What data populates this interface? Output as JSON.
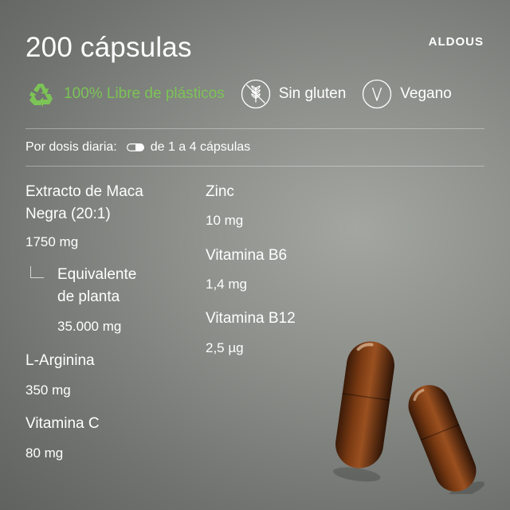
{
  "title": "200 cápsulas",
  "brand": "ALDOUS",
  "badges": {
    "plastic": {
      "label": "100% Libre de plásticos",
      "icon": "recycle-icon",
      "color": "#7cc455"
    },
    "gluten": {
      "label": "Sin gluten",
      "icon": "gluten-free-icon"
    },
    "vegan": {
      "label": "Vegano",
      "icon": "vegan-v-icon"
    }
  },
  "dose": {
    "label": "Por dosis diaria:",
    "icon": "capsule-icon",
    "value": "de 1 a 4 cápsulas"
  },
  "ingredients": {
    "maca": {
      "name_line1": "Extracto de Maca",
      "name_line2": "Negra (20:1)",
      "value": "1750 mg"
    },
    "equivalent": {
      "name_line1": "Equivalente",
      "name_line2": "de planta",
      "value": "35.000 mg"
    },
    "arginine": {
      "name": "L-Arginina",
      "value": "350 mg"
    },
    "vitamin_c": {
      "name": "Vitamina C",
      "value": "80 mg"
    },
    "zinc": {
      "name": "Zinc",
      "value": "10 mg"
    },
    "vitamin_b6": {
      "name": "Vitamina B6",
      "value": "1,4 mg"
    },
    "vitamin_b12": {
      "name": "Vitamina B12",
      "value": "2,5 µg"
    }
  }
}
